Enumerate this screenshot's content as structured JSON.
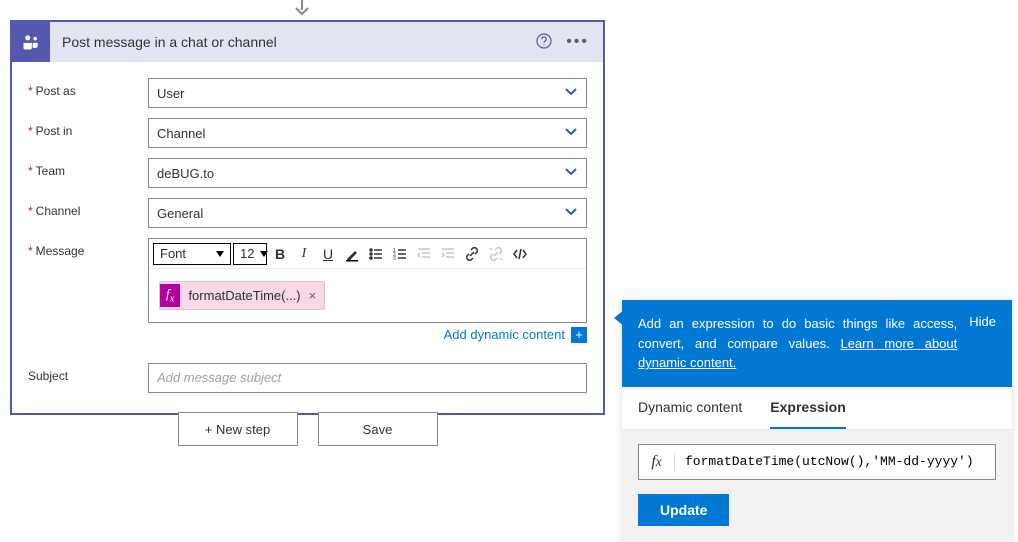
{
  "card": {
    "title": "Post message in a chat or channel",
    "fields": {
      "post_as": {
        "label": "Post as",
        "value": "User",
        "required": true
      },
      "post_in": {
        "label": "Post in",
        "value": "Channel",
        "required": true
      },
      "team": {
        "label": "Team",
        "value": "deBUG.to",
        "required": true
      },
      "channel": {
        "label": "Channel",
        "value": "General",
        "required": true
      },
      "message": {
        "label": "Message",
        "required": true
      },
      "subject": {
        "label": "Subject",
        "placeholder": "Add message subject",
        "required": false
      }
    },
    "rte": {
      "font_label": "Font",
      "font_size": "12",
      "token": "formatDateTime(...)"
    },
    "dynamic_link": "Add dynamic content"
  },
  "footer": {
    "new_step": "+ New step",
    "save": "Save"
  },
  "expr": {
    "banner_text_1": "Add an expression to do basic things like access, convert, and compare values. ",
    "banner_link": "Learn more about dynamic content.",
    "hide": "Hide",
    "tabs": {
      "dyn": "Dynamic content",
      "expr": "Expression"
    },
    "fx": "fx",
    "value": "formatDateTime(utcNow(),'MM-dd-yyyy')",
    "update": "Update"
  }
}
